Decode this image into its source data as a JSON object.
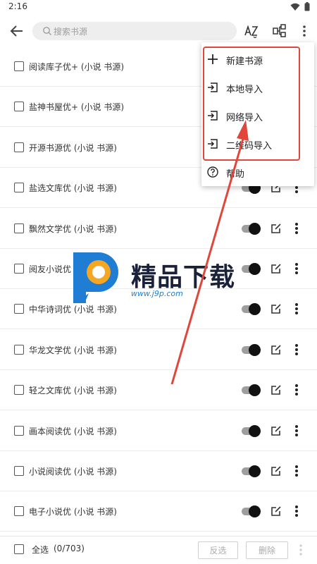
{
  "status_bar": {
    "time": "2:16"
  },
  "toolbar": {
    "search_placeholder": "搜索书源"
  },
  "sources": [
    {
      "label": "阅读库子优+ (小说 书源)",
      "enabled": true
    },
    {
      "label": "盐神书屋优+ (小说 书源)",
      "enabled": true
    },
    {
      "label": "开源书源优 (小说 书源)",
      "enabled": true
    },
    {
      "label": "盐选文库优 (小说 书源)",
      "enabled": true
    },
    {
      "label": "飘然文学优 (小说 书源)",
      "enabled": true
    },
    {
      "label": "阅友小说优 (小说 书源)",
      "enabled": true
    },
    {
      "label": "中华诗词优 (小说 书源)",
      "enabled": true
    },
    {
      "label": "华龙文学优 (小说 书源)",
      "enabled": true
    },
    {
      "label": "轻之文库优 (小说 书源)",
      "enabled": true
    },
    {
      "label": "画本阅读优 (小说 书源)",
      "enabled": true
    },
    {
      "label": "小说阅读优 (小说 书源)",
      "enabled": true
    },
    {
      "label": "电子小说优 (小说 书源)",
      "enabled": true
    }
  ],
  "menu": {
    "items": [
      {
        "label": "新建书源",
        "icon": "plus-icon"
      },
      {
        "label": "本地导入",
        "icon": "import-icon"
      },
      {
        "label": "网络导入",
        "icon": "import-icon"
      },
      {
        "label": "二维码导入",
        "icon": "import-icon"
      },
      {
        "label": "帮助",
        "icon": "help-icon"
      }
    ]
  },
  "bottom_bar": {
    "select_all": "全选",
    "count": "(0/703)",
    "invert_label": "反选",
    "delete_label": "删除"
  },
  "watermark": {
    "text": "精品下载",
    "url": "www.j9p.com"
  },
  "colors": {
    "highlight": "#e0473a",
    "watermark_blue": "#1f7ed3",
    "watermark_orange": "#f5a623"
  }
}
